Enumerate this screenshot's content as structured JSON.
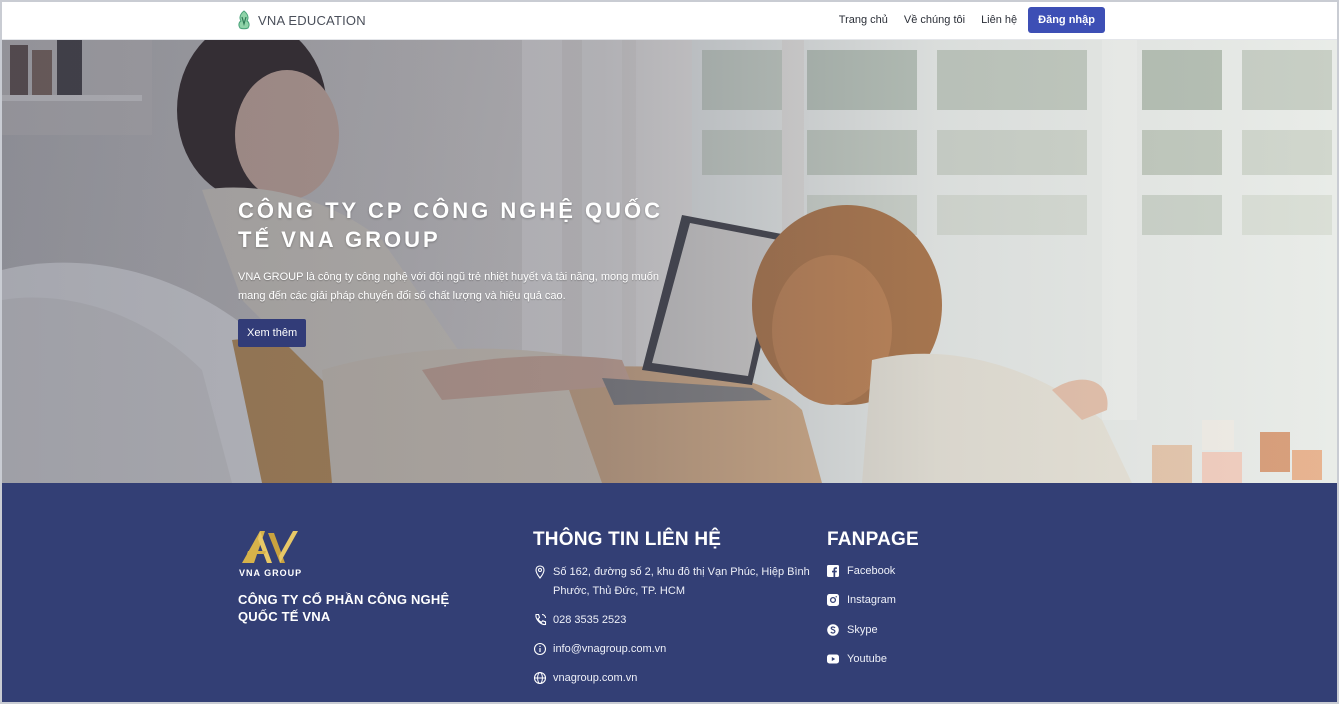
{
  "header": {
    "brand": "VNA EDUCATION",
    "nav": [
      "Trang chủ",
      "Về chúng tôi",
      "Liên hệ"
    ],
    "login": "Đăng nhập"
  },
  "hero": {
    "title_line1": "CÔNG TY CP CÔNG NGHỆ QUỐC",
    "title_line2": "TẾ VNA GROUP",
    "description": "VNA GROUP là công ty công nghệ với đội ngũ trẻ nhiệt huyết và tài năng, mong muốn mang đến các giải pháp chuyển đổi số chất lượng và hiệu quả cao.",
    "button": "Xem thêm"
  },
  "footer": {
    "logo_text": "VNA GROUP",
    "company_name": "CÔNG TY CỔ PHẦN CÔNG NGHỆ QUỐC TẾ VNA",
    "contact_heading": "THÔNG TIN LIÊN HỆ",
    "contact": {
      "address": "Số 162, đường số 2, khu đô thị Vạn Phúc, Hiệp Bình Phước, Thủ Đức, TP. HCM",
      "phone": "028 3535 2523",
      "email": "info@vnagroup.com.vn",
      "website": "vnagroup.com.vn"
    },
    "fanpage_heading": "FANPAGE",
    "social": [
      "Facebook",
      "Instagram",
      "Skype",
      "Youtube"
    ]
  },
  "colors": {
    "primary": "#3d4fb5",
    "footer_bg": "#333f75",
    "hero_button": "#323c78",
    "logo_gold": "#d6b24a"
  },
  "icons": [
    "vna-logo-icon",
    "av-logo-icon",
    "location-pin-icon",
    "phone-icon",
    "info-icon",
    "globe-icon",
    "facebook-icon",
    "instagram-icon",
    "skype-icon",
    "youtube-icon"
  ]
}
